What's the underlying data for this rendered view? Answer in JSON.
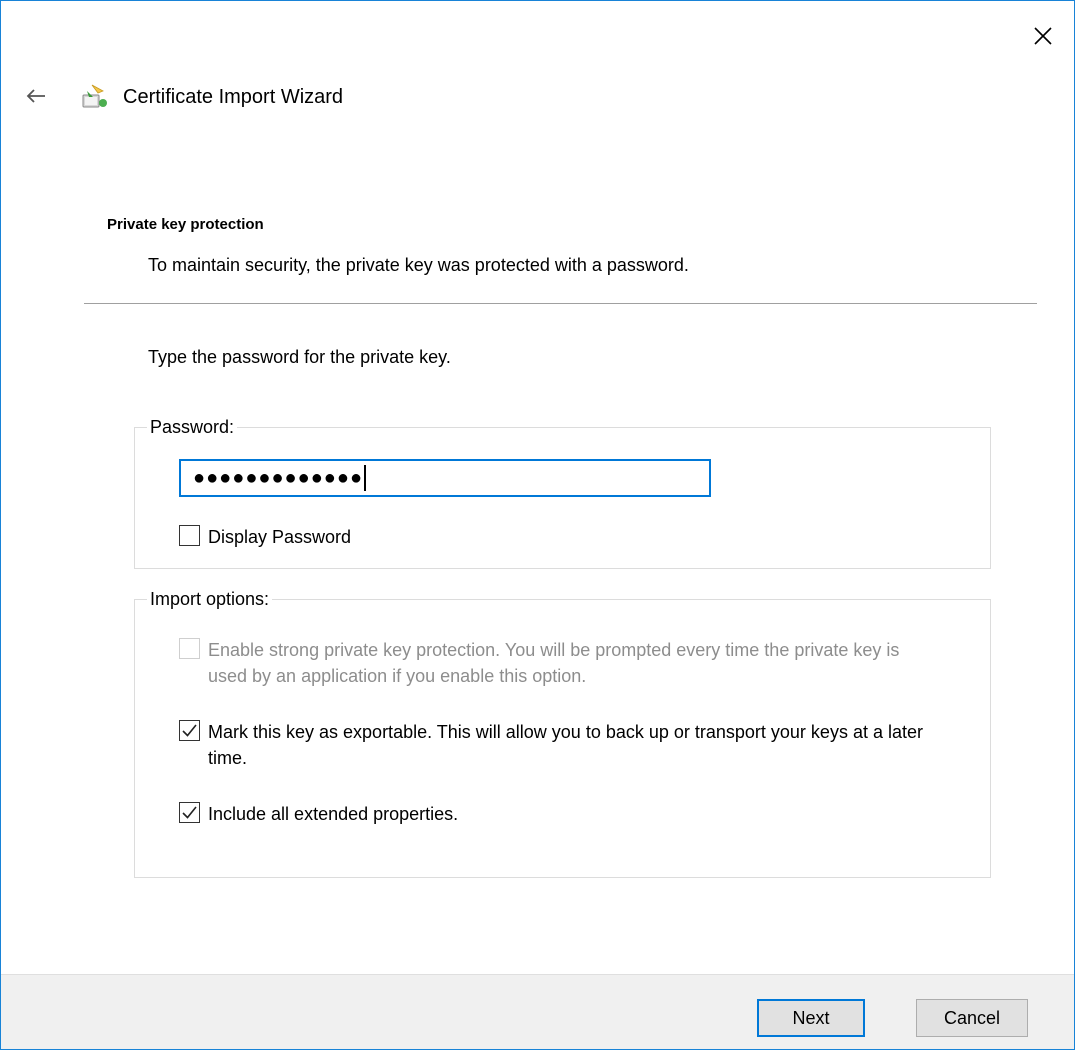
{
  "wizard": {
    "title": "Certificate Import Wizard"
  },
  "section": {
    "title": "Private key protection",
    "description": "To maintain security, the private key was protected with a password."
  },
  "instruction": "Type the password for the private key.",
  "password_group": {
    "legend": "Password:",
    "masked_value": "●●●●●●●●●●●●●",
    "display_password_label": "Display Password",
    "display_password_checked": false
  },
  "import_options": {
    "legend": "Import options:",
    "items": [
      {
        "label": "Enable strong private key protection. You will be prompted every time the private key is used by an application if you enable this option.",
        "checked": false,
        "enabled": false
      },
      {
        "label": "Mark this key as exportable. This will allow you to back up or transport your keys at a later time.",
        "checked": true,
        "enabled": true
      },
      {
        "label": "Include all extended properties.",
        "checked": true,
        "enabled": true
      }
    ]
  },
  "buttons": {
    "next": "Next",
    "cancel": "Cancel"
  },
  "colors": {
    "accent": "#0078d7",
    "window_border": "#1883d7",
    "footer_bg": "#f0f0f0"
  },
  "icons": [
    "close-icon",
    "back-arrow-icon",
    "certificate-wizard-icon",
    "checkmark-icon"
  ]
}
